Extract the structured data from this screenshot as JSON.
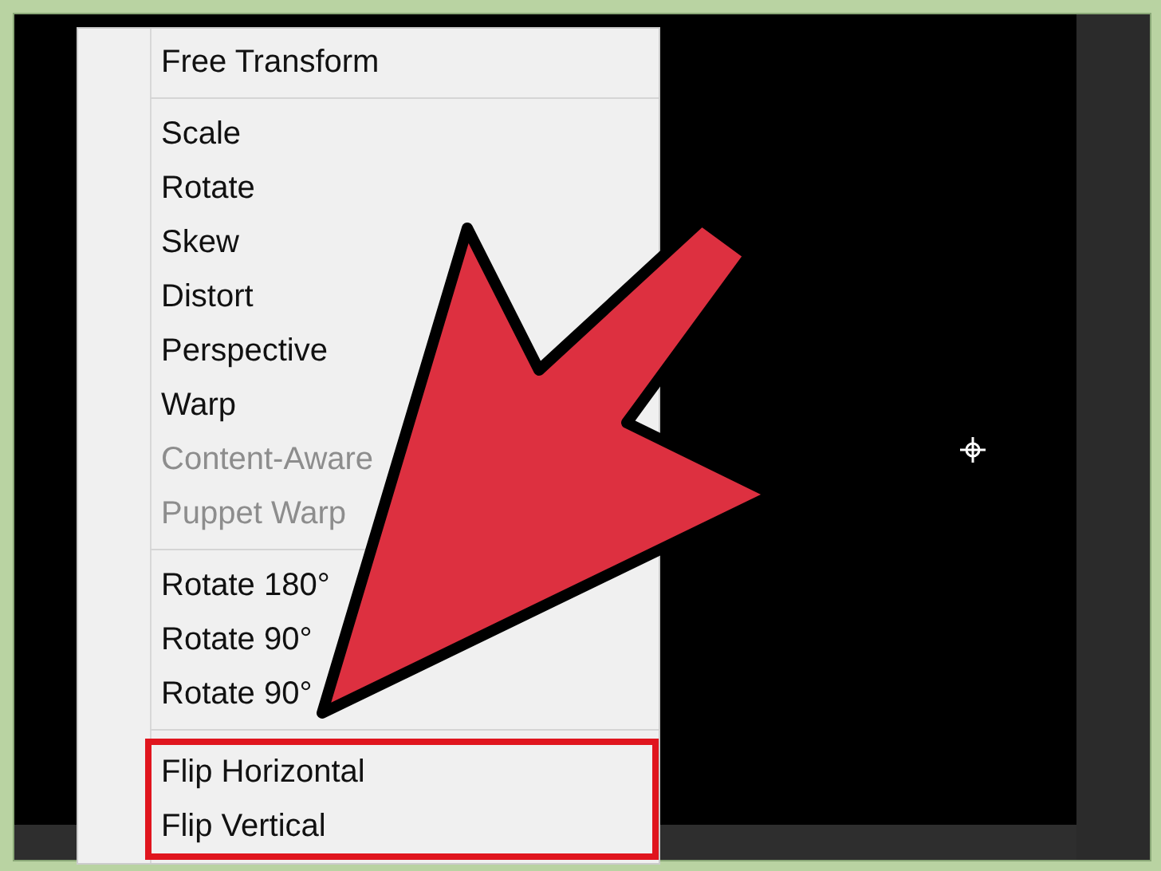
{
  "context_menu": {
    "groups": [
      {
        "highlighted": false,
        "items": [
          {
            "label": "Free Transform",
            "disabled": false
          }
        ]
      },
      {
        "highlighted": false,
        "items": [
          {
            "label": "Scale",
            "disabled": false
          },
          {
            "label": "Rotate",
            "disabled": false
          },
          {
            "label": "Skew",
            "disabled": false
          },
          {
            "label": "Distort",
            "disabled": false
          },
          {
            "label": "Perspective",
            "disabled": false
          },
          {
            "label": "Warp",
            "disabled": false
          },
          {
            "label": "Content-Aware",
            "disabled": true
          },
          {
            "label": "Puppet Warp",
            "disabled": true
          }
        ]
      },
      {
        "highlighted": false,
        "items": [
          {
            "label": "Rotate 180°",
            "disabled": false
          },
          {
            "label": "Rotate 90°",
            "disabled": false
          },
          {
            "label": "Rotate 90°",
            "disabled": false
          }
        ]
      },
      {
        "highlighted": true,
        "items": [
          {
            "label": "Flip Horizontal",
            "disabled": false
          },
          {
            "label": "Flip Vertical",
            "disabled": false
          }
        ]
      }
    ]
  }
}
